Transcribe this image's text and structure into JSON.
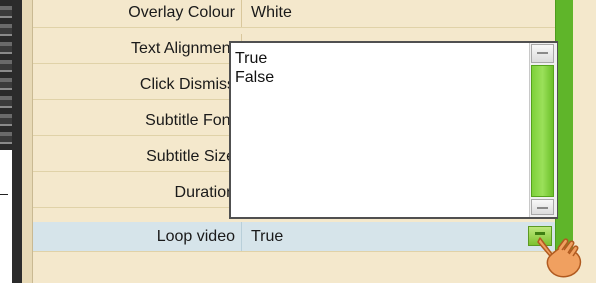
{
  "properties": {
    "rows": [
      {
        "label": "Overlay Colour",
        "value": "White"
      },
      {
        "label": "Text Alignment",
        "value": ""
      },
      {
        "label": "Click Dismiss",
        "value": ""
      },
      {
        "label": "Subtitle Font",
        "value": ""
      },
      {
        "label": "Subtitle Size",
        "value": ""
      },
      {
        "label": "Duration",
        "value": ""
      },
      {
        "label": "Loop video",
        "value": "True"
      }
    ]
  },
  "dropdown": {
    "options": [
      "True",
      "False"
    ]
  },
  "icons": {
    "dropdown_button": "chevron-down-icon",
    "cursor": "hand-pointer-icon"
  },
  "colors": {
    "panel_background": "#f4e8cc",
    "selected_row": "#d6e4ea",
    "accent_green": "#5fb52a"
  }
}
